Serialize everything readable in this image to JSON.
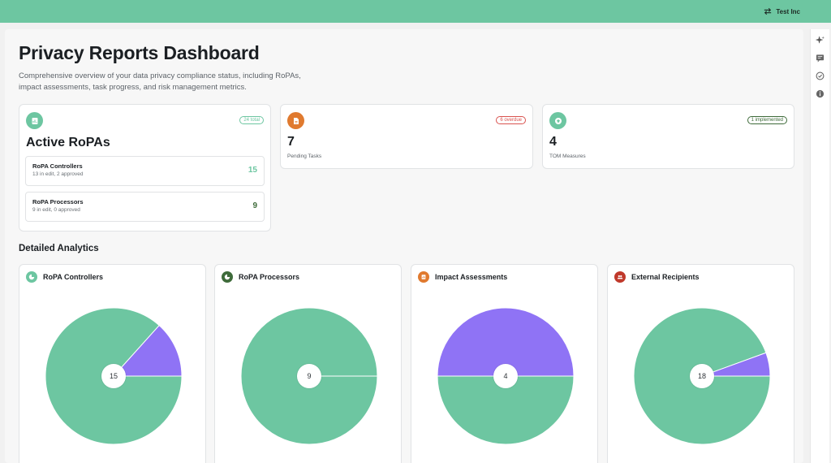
{
  "header": {
    "org_name": "Test Inc",
    "org_icon": "swap-icon"
  },
  "page": {
    "title": "Privacy Reports Dashboard",
    "description": "Comprehensive overview of your data privacy compliance status, including RoPAs, impact assessments, task progress, and risk management metrics."
  },
  "ropa_card": {
    "icon": "document-chart-icon",
    "badge": "24 total",
    "title": "Active RoPAs",
    "items": [
      {
        "name": "RoPA Controllers",
        "meta": "13 in edit, 2 approved",
        "value": "15"
      },
      {
        "name": "RoPA Processors",
        "meta": "9 in edit, 0 approved",
        "value": "9"
      }
    ]
  },
  "tasks_card": {
    "icon": "file-icon",
    "badge": "6 overdue",
    "value": "7",
    "label": "Pending Tasks"
  },
  "tom_card": {
    "icon": "shield-icon",
    "badge": "1 implemented",
    "value": "4",
    "label": "TOM Measures"
  },
  "analytics": {
    "title": "Detailed Analytics",
    "charts": [
      {
        "title": "RoPA Controllers",
        "icon": "pie-icon",
        "icon_color": "#6dc6a1",
        "total": "15"
      },
      {
        "title": "RoPA Processors",
        "icon": "pie-icon",
        "icon_color": "#3e6b3a",
        "total": "9"
      },
      {
        "title": "Impact Assessments",
        "icon": "report-icon",
        "icon_color": "#e07a2f",
        "total": "4"
      },
      {
        "title": "External Recipients",
        "icon": "users-icon",
        "icon_color": "#c0392b",
        "total": "18"
      }
    ]
  },
  "colors": {
    "brand": "#6dc6a1",
    "purple": "#8f73f5",
    "orange": "#e07a2f",
    "overdue": "#d9534f",
    "dark_green": "#3e6b3a"
  },
  "chart_data": [
    {
      "type": "pie",
      "title": "RoPA Controllers",
      "slices": [
        {
          "value": 13,
          "color": "#6dc6a1"
        },
        {
          "value": 2,
          "color": "#8f73f5"
        }
      ]
    },
    {
      "type": "pie",
      "title": "RoPA Processors",
      "slices": [
        {
          "value": 9,
          "color": "#6dc6a1"
        },
        {
          "value": 0,
          "color": "#8f73f5"
        }
      ]
    },
    {
      "type": "pie",
      "title": "Impact Assessments",
      "slices": [
        {
          "value": 2,
          "color": "#6dc6a1"
        },
        {
          "value": 2,
          "color": "#8f73f5"
        }
      ]
    },
    {
      "type": "pie",
      "title": "External Recipients",
      "slices": [
        {
          "value": 17,
          "color": "#6dc6a1"
        },
        {
          "value": 1,
          "color": "#8f73f5"
        }
      ]
    }
  ]
}
